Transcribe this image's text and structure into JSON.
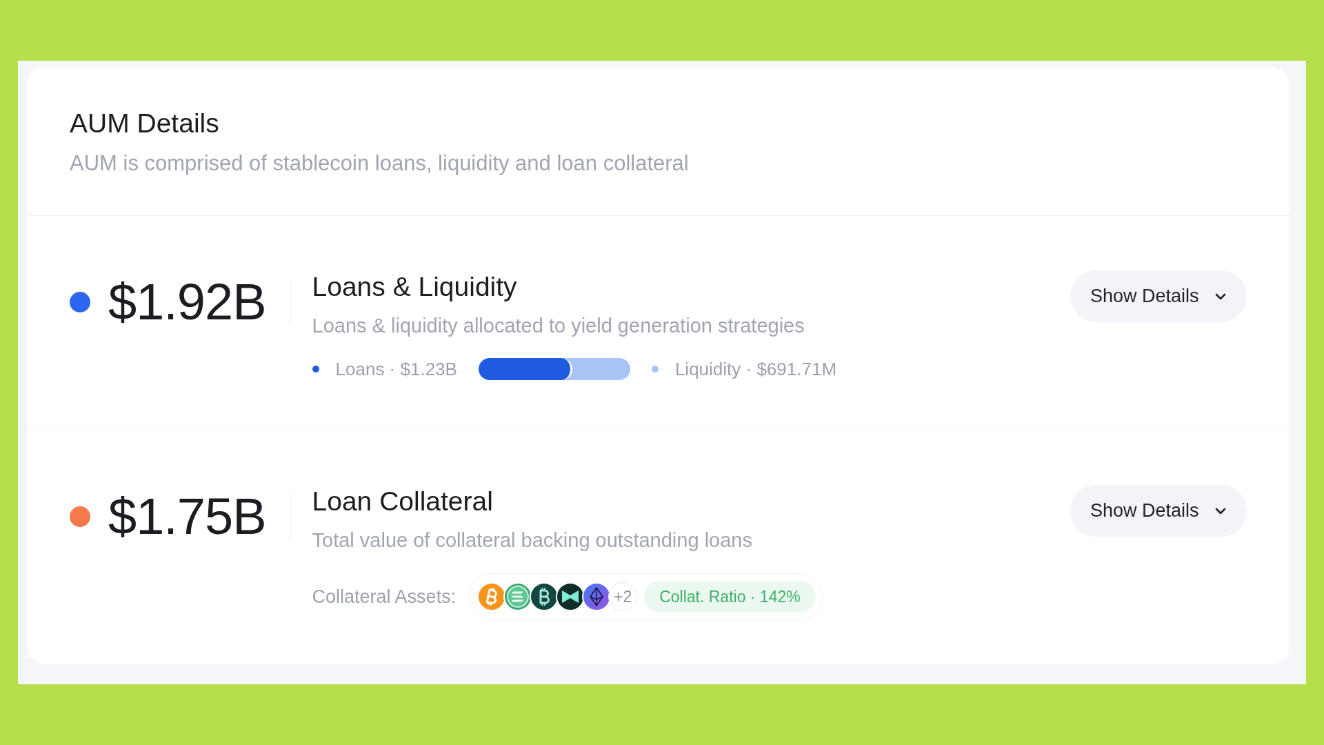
{
  "card": {
    "title": "AUM Details",
    "subtitle": "AUM is comprised of stablecoin loans, liquidity and loan collateral"
  },
  "sections": [
    {
      "kind": "breakdown",
      "color": "#2a66f0",
      "amount": "$1.92B",
      "title": "Loans & Liquidity",
      "description": "Loans & liquidity allocated to yield generation strategies",
      "details_button": {
        "label": "Show Details",
        "expanded": false
      },
      "split": {
        "level": 0.62,
        "items": [
          {
            "label": "Loans · $1.23B",
            "color": "#1f5bde"
          },
          {
            "label": "Liquidity · $691.71M",
            "color": "#a9c3f6"
          }
        ]
      }
    },
    {
      "kind": "collateral",
      "color": "#f5794a",
      "amount": "$1.75B",
      "title": "Loan Collateral",
      "description": "Total value of collateral backing outstanding loans",
      "details_button": {
        "label": "Show Details",
        "expanded": false
      },
      "assets_label": "Collateral Assets:",
      "assets": [
        {
          "kind": "bsign"
        },
        {
          "kind": "stripes"
        },
        {
          "kind": "bsigndark"
        },
        {
          "kind": "bowtie"
        },
        {
          "kind": "diamond"
        }
      ],
      "more_count": "+2",
      "ratio": "Collat. Ratio · 142%"
    }
  ]
}
